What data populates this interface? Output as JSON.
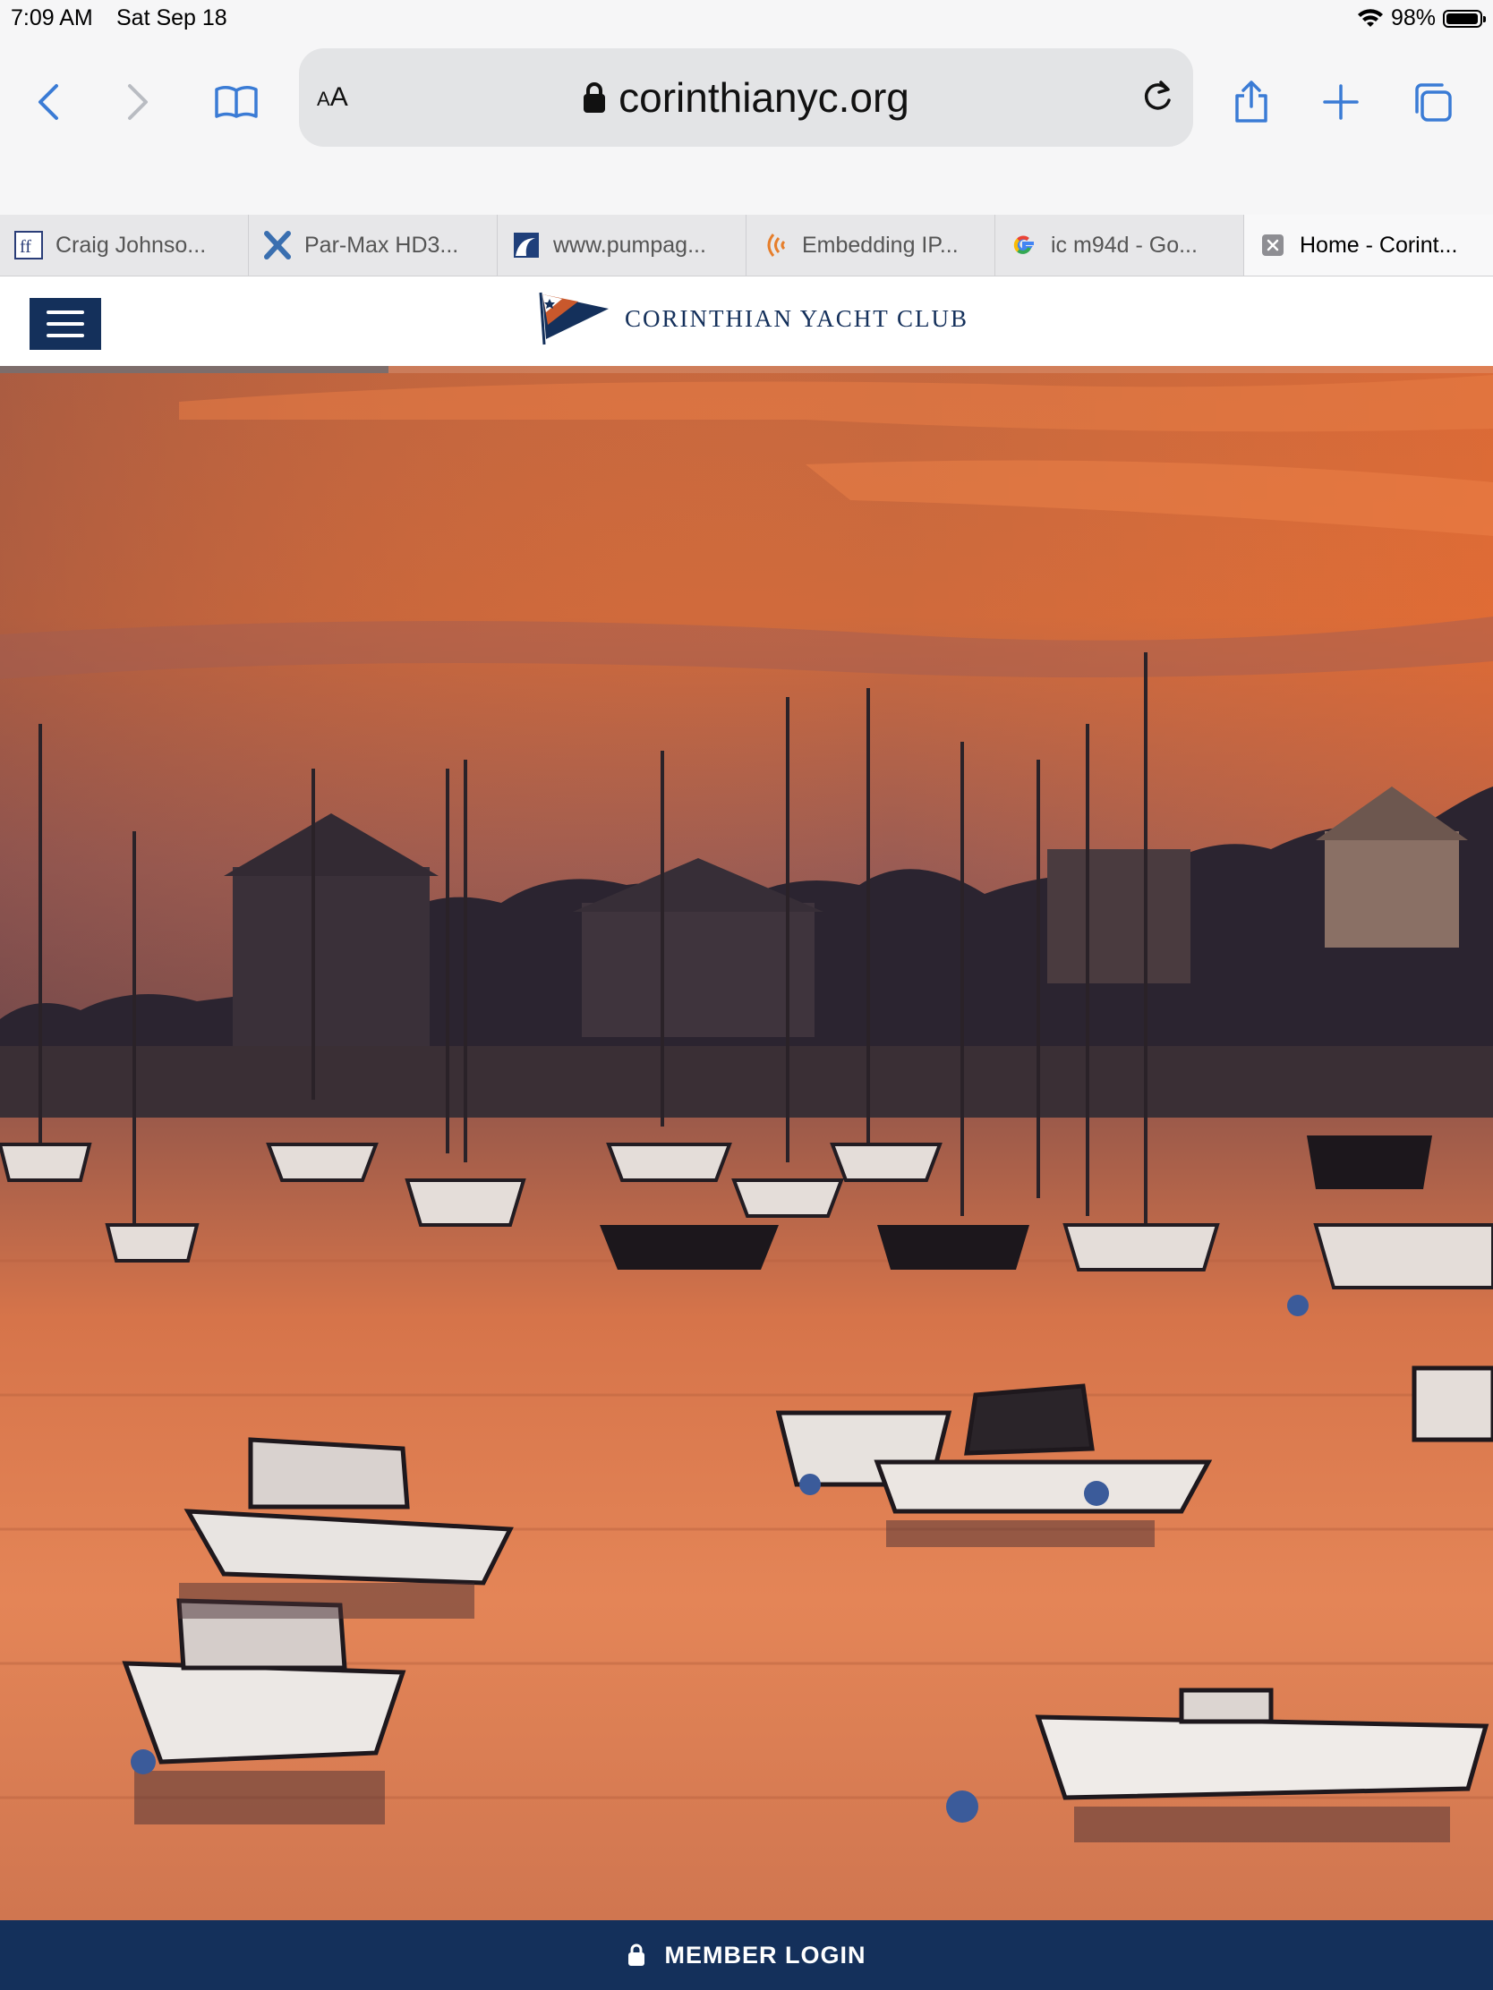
{
  "status_bar": {
    "time": "7:09 AM",
    "date": "Sat Sep 18",
    "battery": "98%",
    "battery_level": 0.98
  },
  "browser": {
    "text_size_label": "AA",
    "url": "corinthianyc.org",
    "tabs": [
      {
        "title": "Craig Johnso...",
        "icon": "ff-icon"
      },
      {
        "title": "Par-Max HD3...",
        "icon": "x-icon"
      },
      {
        "title": "www.pumpag...",
        "icon": "wave-icon"
      },
      {
        "title": "Embedding IP...",
        "icon": "signal-icon"
      },
      {
        "title": "ic m94d - Go...",
        "icon": "google-icon"
      },
      {
        "title": "Home - Corint...",
        "icon": "close-icon",
        "active": true
      }
    ]
  },
  "site": {
    "logo_text": "CORINTHIAN YACHT CLUB",
    "brand_color": "#14305b",
    "hero_progress": 0.26,
    "member_login": "MEMBER LOGIN"
  }
}
